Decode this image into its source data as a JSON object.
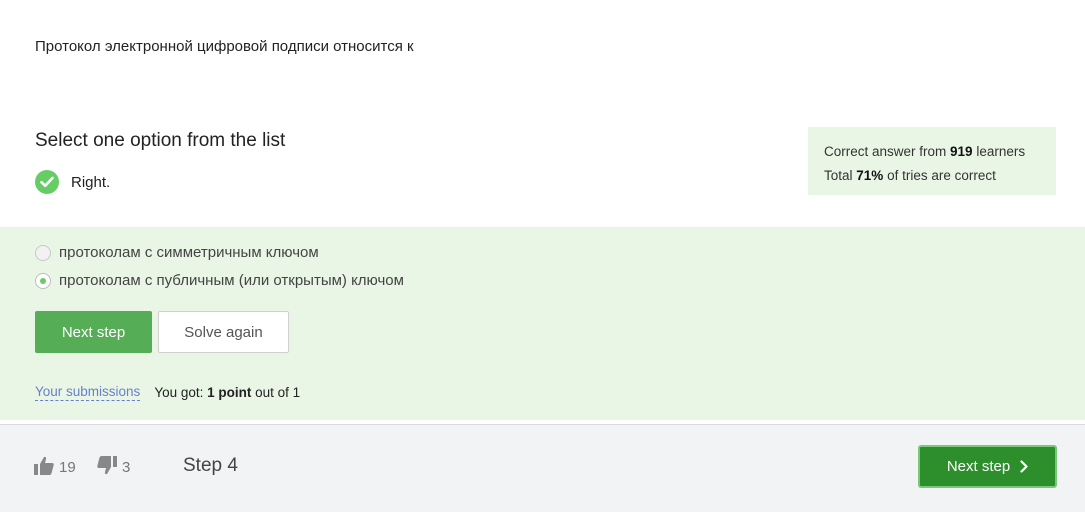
{
  "question": "Протокол электронной цифровой подписи относится к",
  "heading": "Select one option from the list",
  "result": {
    "text": "Right."
  },
  "stats": {
    "line1_prefix": "Correct answer from ",
    "learners": "919",
    "line1_suffix": " learners",
    "line2_prefix": "Total ",
    "percent": "71%",
    "line2_suffix": " of tries are correct"
  },
  "options": [
    {
      "label": "протоколам с симметричным ключом",
      "selected": false
    },
    {
      "label": "протоколам с публичным (или открытым) ключом",
      "selected": true
    }
  ],
  "buttons": {
    "next_step": "Next step",
    "solve_again": "Solve again"
  },
  "submissions": {
    "link": "Your submissions",
    "got_prefix": "You got: ",
    "points": "1 point",
    "got_suffix": " out of 1"
  },
  "footer": {
    "likes": "19",
    "dislikes": "3",
    "step": "Step 4",
    "next_step": "Next step"
  },
  "colors": {
    "accent_green": "#66cc66",
    "answer_bg": "#e9f6e5",
    "button_green": "#55ad55",
    "footer_button_green": "#2c8f2c",
    "link_blue": "#6680cc"
  },
  "icons": [
    "check-icon",
    "thumbs-up-icon",
    "thumbs-down-icon",
    "chevron-right-icon"
  ]
}
